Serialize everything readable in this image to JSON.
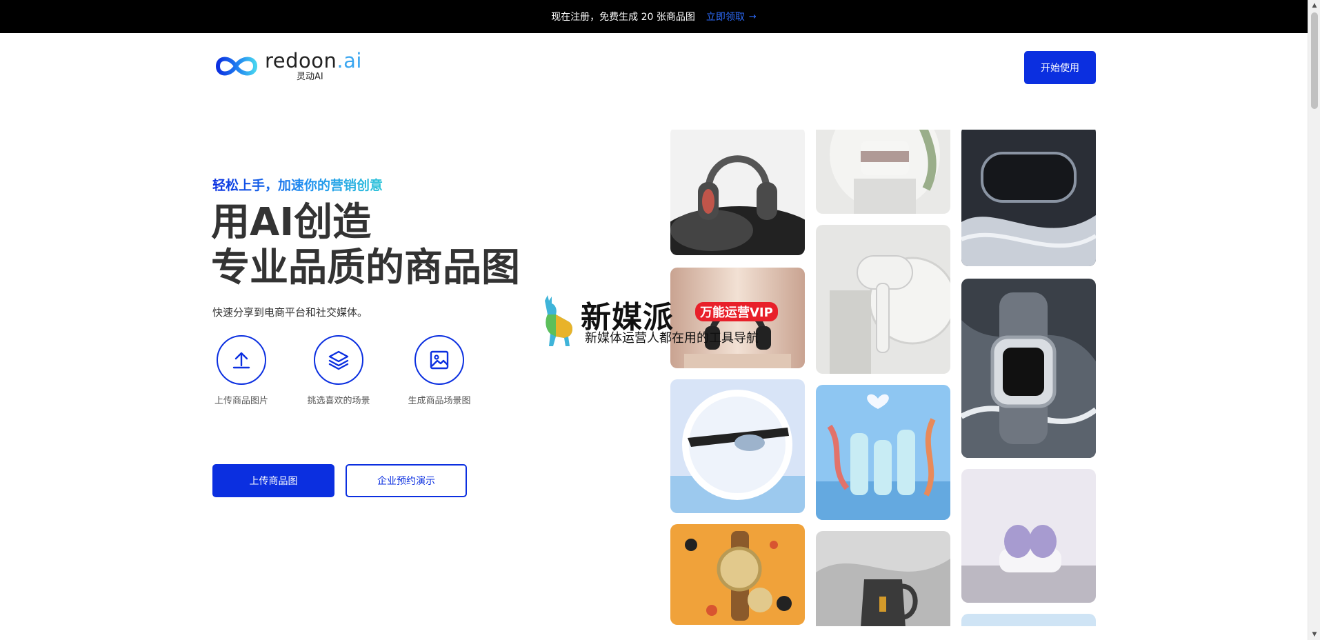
{
  "banner": {
    "text": "现在注册，免费生成 20 张商品图",
    "link_label": "立即领取",
    "link_arrow": "→"
  },
  "header": {
    "logo_name": "redoon",
    "logo_name_suffix": ".ai",
    "logo_cn": "灵动AI",
    "start_label": "开始使用"
  },
  "hero": {
    "eyebrow": "轻松上手，加速你的营销创意",
    "headline_line1": "用AI创造",
    "headline_line2": "专业品质的商品图",
    "subline": "快速分享到电商平台和社交媒体。",
    "steps": [
      {
        "icon": "upload-icon",
        "label": "上传商品图片"
      },
      {
        "icon": "layers-icon",
        "label": "挑选喜欢的场景"
      },
      {
        "icon": "image-icon",
        "label": "生成商品场景图"
      }
    ],
    "cta_primary": "上传商品图",
    "cta_secondary": "企业预约演示"
  },
  "watermark": {
    "title": "新媒派",
    "badge": "万能运营VIP",
    "subtitle": "新媒体运营人都在用的工具导航"
  },
  "colors": {
    "brand": "#0b2fe0",
    "banner_bg": "#000000",
    "banner_link": "#2e6dff",
    "eyebrow_start": "#0b2fe0",
    "eyebrow_end": "#2cc4d8"
  }
}
